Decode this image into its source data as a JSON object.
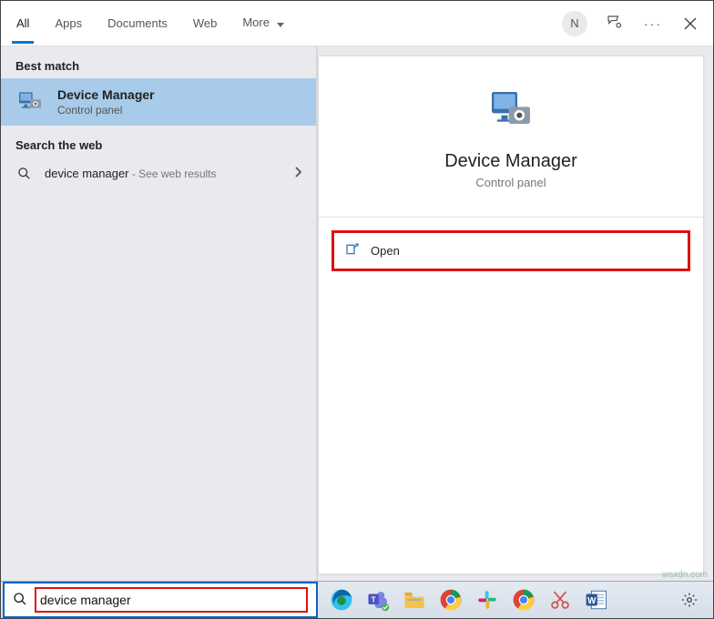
{
  "header": {
    "tabs": [
      "All",
      "Apps",
      "Documents",
      "Web",
      "More"
    ],
    "activeTab": "All",
    "avatar": "N"
  },
  "left": {
    "bestMatchLabel": "Best match",
    "result": {
      "title": "Device Manager",
      "subtitle": "Control panel"
    },
    "webLabel": "Search the web",
    "webQuery": "device manager",
    "webHint": " - See web results"
  },
  "right": {
    "title": "Device Manager",
    "subtitle": "Control panel",
    "openLabel": "Open"
  },
  "taskbar": {
    "searchValue": "device manager",
    "apps": [
      {
        "name": "edge",
        "color": "#1f8ad6",
        "shape": "edge"
      },
      {
        "name": "teams",
        "color": "#5558af",
        "shape": "teams"
      },
      {
        "name": "file-explorer",
        "color": "#f6c24a",
        "shape": "folder"
      },
      {
        "name": "chrome",
        "color": "#fff",
        "shape": "chrome"
      },
      {
        "name": "slack",
        "color": "#4a154b",
        "shape": "slack"
      },
      {
        "name": "chrome-alt",
        "color": "#fff",
        "shape": "chrome"
      },
      {
        "name": "snip",
        "color": "#d2584f",
        "shape": "scissors"
      },
      {
        "name": "word",
        "color": "#2b579a",
        "shape": "word"
      }
    ]
  },
  "watermark": "wsxdn.com"
}
